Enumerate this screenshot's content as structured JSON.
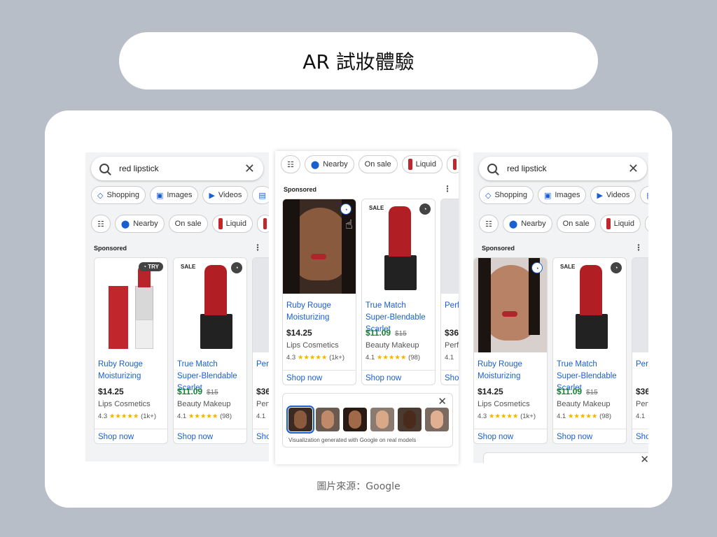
{
  "header": {
    "title": "AR 試妝體驗"
  },
  "caption": "圖片來源：Google",
  "search": {
    "query": "red lipstick"
  },
  "tabs": [
    {
      "label": "Shopping",
      "icon": "tag-icon"
    },
    {
      "label": "Images",
      "icon": "image-icon"
    },
    {
      "label": "Videos",
      "icon": "play-icon"
    }
  ],
  "filters": [
    {
      "label": "",
      "icon": "filter-sliders-icon"
    },
    {
      "label": "Nearby",
      "icon": "location-pin-icon"
    },
    {
      "label": "On sale",
      "icon": ""
    },
    {
      "label": "Liquid",
      "icon": "lipstick-thumb-icon"
    }
  ],
  "sponsored": "Sponsored",
  "products": [
    {
      "name": "Ruby Rouge Moisturizing",
      "price": "$14.25",
      "old_price": "",
      "store": "Lips Cosmetics",
      "rating": "4.3",
      "stars": "★★★★★",
      "reviews": "(1k+)",
      "shop": "Shop now",
      "badge": "",
      "try": "TRY"
    },
    {
      "name": "True Match Super-Blendable Scarlet",
      "price": "$11.09",
      "old_price": "$15",
      "store": "Beauty Makeup",
      "rating": "4.1",
      "stars": "★★★★★",
      "reviews": "(98)",
      "shop": "Shop now",
      "badge": "SALE",
      "try": ""
    },
    {
      "name": "Perf Bloo",
      "price": "$36",
      "old_price": "",
      "store": "Perf",
      "rating": "4.1",
      "stars": "",
      "reviews": "",
      "shop": "Sho",
      "badge": "",
      "try": ""
    }
  ],
  "models_caption": "Visualization generated with Google on real models",
  "colors": {
    "accent_blue": "#1a5fd0",
    "sale_green": "#188038",
    "star": "#f2b400",
    "lipstick_red": "#c0262c"
  }
}
